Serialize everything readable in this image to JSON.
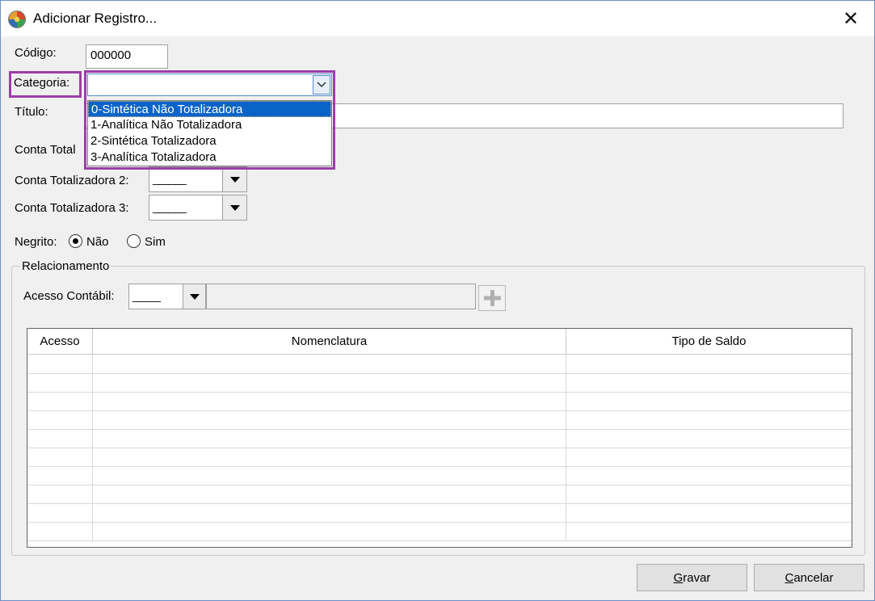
{
  "window": {
    "title": "Adicionar Registro...",
    "close_glyph": "✕"
  },
  "form": {
    "codigo_label": "Código:",
    "codigo_value": "000000",
    "categoria_label": "Categoria:",
    "categoria_value": "",
    "titulo_label": "Título:",
    "titulo_value": "",
    "conta1_label": "Conta Total",
    "conta2_label": "Conta Totalizadora 2:",
    "conta2_value": "______",
    "conta3_label": "Conta Totalizadora 3:",
    "conta3_value": "______",
    "negrito_label": "Negrito:",
    "negrito_options": [
      {
        "label": "Não",
        "checked": true
      },
      {
        "label": "Sim",
        "checked": false
      }
    ]
  },
  "categoria_dropdown": {
    "options": [
      "0-Sintética Não Totalizadora",
      "1-Analítica Não Totalizadora",
      "2-Sintética Totalizadora",
      "3-Analítica Totalizadora"
    ],
    "selected_index": 0
  },
  "relacionamento": {
    "legend": "Relacionamento",
    "acesso_label": "Acesso Contábil:",
    "acesso_value": "_____",
    "acesso_desc": ""
  },
  "grid": {
    "columns": [
      "Acesso",
      "Nomenclatura",
      "Tipo de Saldo"
    ],
    "empty_rows": 10
  },
  "buttons": {
    "gravar_mnemonic": "G",
    "gravar_rest": "ravar",
    "cancelar_mnemonic": "C",
    "cancelar_rest": "ancelar"
  },
  "colors": {
    "highlight": "#9b3fa8",
    "selection": "#0a64c8",
    "window_border": "#6b8fc9"
  },
  "icons": {
    "app": "app-logo-icon",
    "close": "close-icon",
    "dropdown": "chevron-down-icon",
    "add": "plus-icon"
  }
}
